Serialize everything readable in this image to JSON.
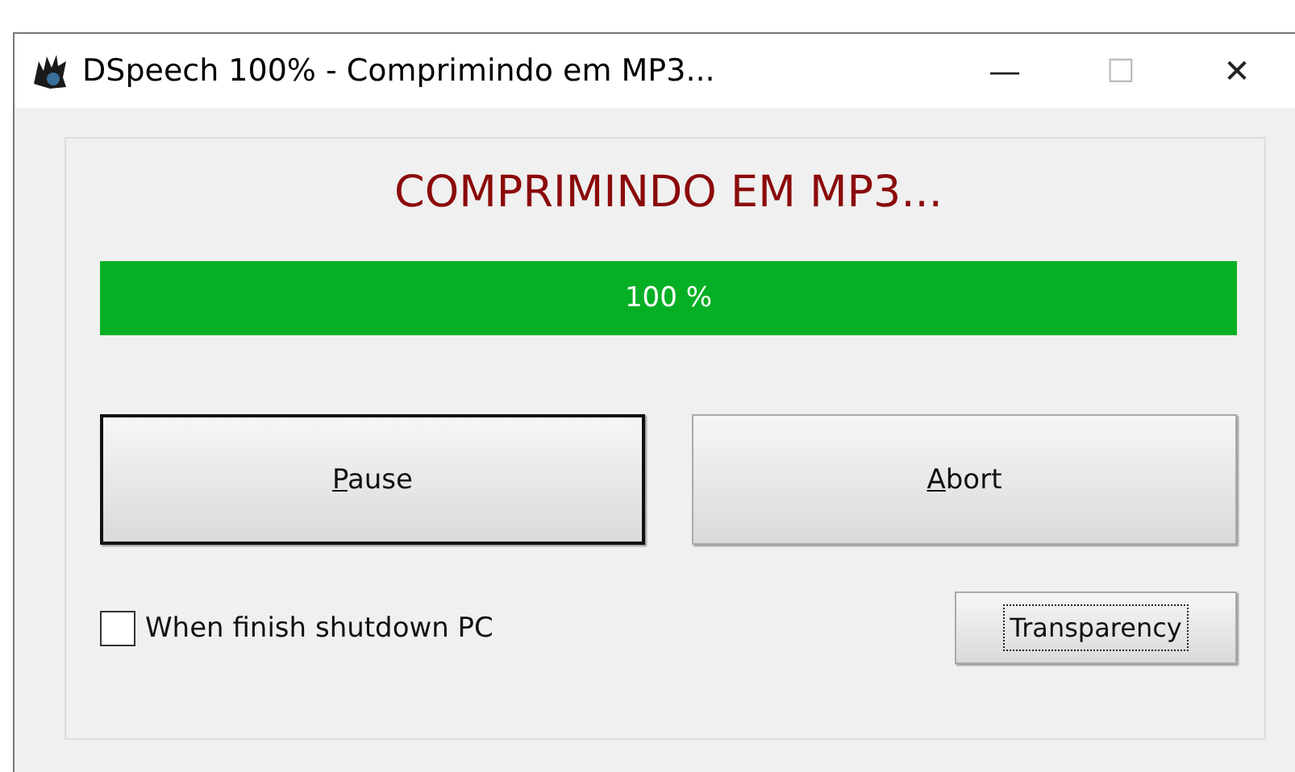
{
  "window": {
    "title": "DSpeech 100% - Comprimindo em MP3...",
    "controls": [
      "—",
      "☐",
      "✕"
    ]
  },
  "heading": "COMPRIMINDO EM MP3...",
  "progress": {
    "level": 1,
    "reading": "100 %"
  },
  "buttons": [
    {
      "label": "Pause",
      "access_key_underlined": true,
      "default": true
    },
    {
      "label": "Abort",
      "access_key_underlined": true,
      "default": false
    }
  ],
  "shutdown_checkbox": {
    "label": "When finish shutdown PC",
    "checked": false
  },
  "transparency_button": {
    "label": "Transparency",
    "focused": true
  }
}
